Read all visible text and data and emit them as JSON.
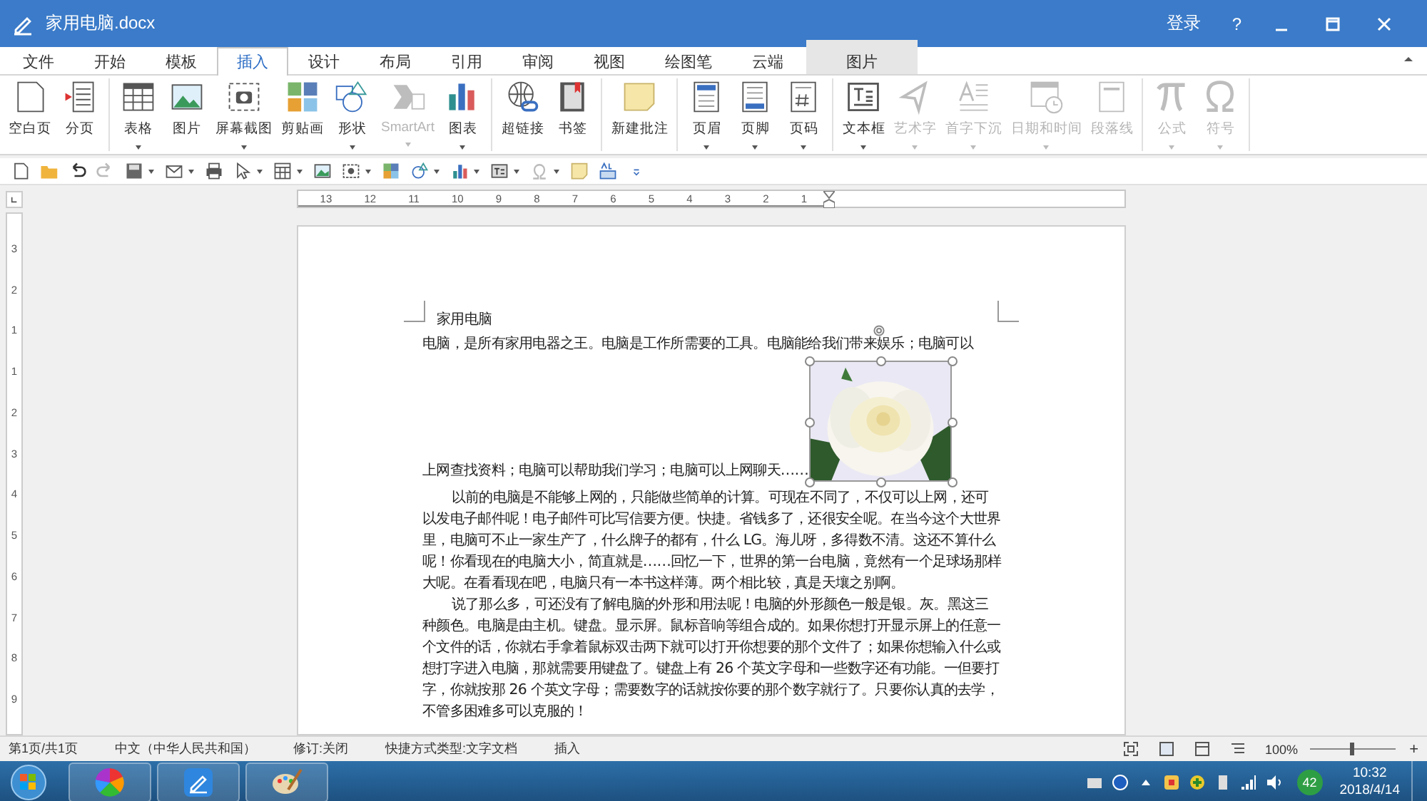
{
  "window": {
    "title": "家用电脑.docx",
    "login": "登录",
    "help": "?"
  },
  "tabs": [
    {
      "label": "文件",
      "selected": false,
      "kind": "normal"
    },
    {
      "label": "开始",
      "selected": false,
      "kind": "normal"
    },
    {
      "label": "模板",
      "selected": false,
      "kind": "normal"
    },
    {
      "label": "插入",
      "selected": true,
      "kind": "normal"
    },
    {
      "label": "设计",
      "selected": false,
      "kind": "normal"
    },
    {
      "label": "布局",
      "selected": false,
      "kind": "normal"
    },
    {
      "label": "引用",
      "selected": false,
      "kind": "normal"
    },
    {
      "label": "审阅",
      "selected": false,
      "kind": "normal"
    },
    {
      "label": "视图",
      "selected": false,
      "kind": "normal"
    },
    {
      "label": "绘图笔",
      "selected": false,
      "kind": "normal"
    },
    {
      "label": "云端",
      "selected": false,
      "kind": "normal"
    },
    {
      "label": "图片",
      "selected": false,
      "kind": "contextual"
    }
  ],
  "ribbon": {
    "groups": [
      {
        "items": [
          {
            "label": "空白页",
            "dropdown": false,
            "disabled": false
          },
          {
            "label": "分页",
            "dropdown": false,
            "disabled": false
          }
        ]
      },
      {
        "items": [
          {
            "label": "表格",
            "dropdown": true,
            "disabled": false
          },
          {
            "label": "图片",
            "dropdown": false,
            "disabled": false
          },
          {
            "label": "屏幕截图",
            "dropdown": true,
            "disabled": false
          },
          {
            "label": "剪贴画",
            "dropdown": false,
            "disabled": false
          },
          {
            "label": "形状",
            "dropdown": true,
            "disabled": false
          },
          {
            "label": "SmartArt",
            "dropdown": true,
            "disabled": true
          },
          {
            "label": "图表",
            "dropdown": true,
            "disabled": false
          }
        ]
      },
      {
        "items": [
          {
            "label": "超链接",
            "dropdown": false,
            "disabled": false
          },
          {
            "label": "书签",
            "dropdown": false,
            "disabled": false
          }
        ]
      },
      {
        "items": [
          {
            "label": "新建批注",
            "dropdown": false,
            "disabled": false
          }
        ]
      },
      {
        "items": [
          {
            "label": "页眉",
            "dropdown": true,
            "disabled": false
          },
          {
            "label": "页脚",
            "dropdown": true,
            "disabled": false
          },
          {
            "label": "页码",
            "dropdown": true,
            "disabled": false
          }
        ]
      },
      {
        "items": [
          {
            "label": "文本框",
            "dropdown": true,
            "disabled": false
          },
          {
            "label": "艺术字",
            "dropdown": true,
            "disabled": true
          },
          {
            "label": "首字下沉",
            "dropdown": true,
            "disabled": true
          },
          {
            "label": "日期和时间",
            "dropdown": true,
            "disabled": true
          },
          {
            "label": "段落线",
            "dropdown": false,
            "disabled": true
          }
        ]
      },
      {
        "items": [
          {
            "label": "公式",
            "dropdown": true,
            "disabled": true
          },
          {
            "label": "符号",
            "dropdown": true,
            "disabled": true
          }
        ]
      }
    ]
  },
  "ruler": {
    "numbers": [
      "13",
      "12",
      "11",
      "10",
      "9",
      "8",
      "7",
      "6",
      "5",
      "4",
      "3",
      "2",
      "1"
    ]
  },
  "vertical_ruler": {
    "numbers": [
      "3",
      "2",
      "1",
      "1",
      "2",
      "3",
      "4",
      "5",
      "6",
      "7",
      "8",
      "9"
    ]
  },
  "document": {
    "title": "家用电脑",
    "intro_line": "电脑，是所有家用电器之王。电脑是工作所需要的工具。电脑能给我们带来娱乐；电脑可以",
    "image": {
      "kind": "picture",
      "selected": true
    },
    "intro_continued": "上网查找资料；电脑可以帮助我们学习；电脑可以上网聊天……",
    "paragraphs": [
      "以前的电脑是不能够上网的，只能做些简单的计算。可现在不同了，不仅可以上网，还可以发电子邮件呢！电子邮件可比写信要方便。快捷。省钱多了，还很安全呢。在当今这个大世界里，电脑可不止一家生产了，什么牌子的都有，什么 LG。海儿呀，多得数不清。这还不算什么呢！你看现在的电脑大小，简直就是……回忆一下，世界的第一台电脑，竟然有一个足球场那样大呢。在看看现在吧，电脑只有一本书这样薄。两个相比较，真是天壤之别啊。",
      "说了那么多，可还没有了解电脑的外形和用法呢！电脑的外形颜色一般是银。灰。黑这三种颜色。电脑是由主机。键盘。显示屏。鼠标音响等组合成的。如果你想打开显示屏上的任意一个文件的话，你就右手拿着鼠标双击两下就可以打开你想要的那个文件了；如果你想输入什么或想打字进入电脑，那就需要用键盘了。键盘上有 26 个英文字母和一些数字还有功能。一但要打字，你就按那 26 个英文字母；需要数字的话就按你要的那个数字就行了。只要你认真的去学，不管多困难多可以克服的！"
    ]
  },
  "status_bar": {
    "items": [
      "第1页/共1页",
      "中文（中华人民共和国）",
      "修订:关闭",
      "快捷方式类型:文字文档",
      "插入"
    ],
    "zoom": "100%",
    "zoom_in": "+",
    "zoom_slider": {
      "level": 0.5
    }
  },
  "taskbar": {
    "badge": "42",
    "time": "10:32",
    "date": "2018/4/14"
  }
}
